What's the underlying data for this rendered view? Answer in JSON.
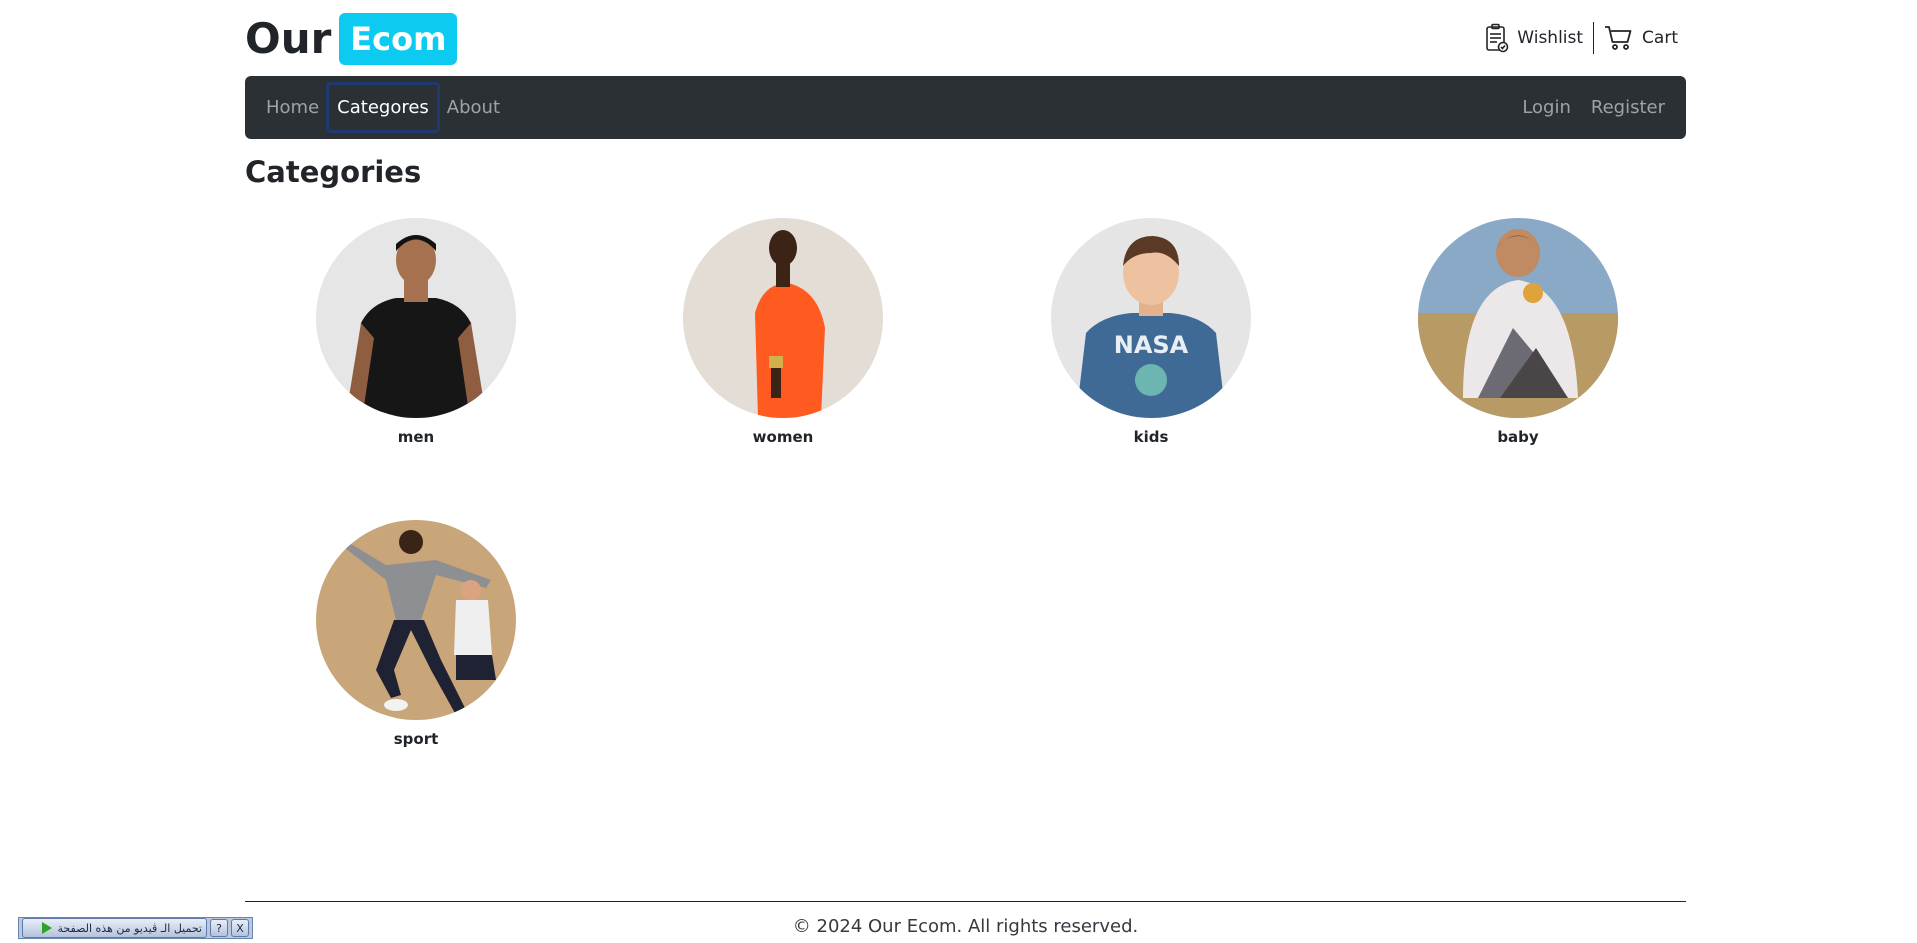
{
  "brand": {
    "word": "Our",
    "badge": "Ecom",
    "badge_color": "#0dcaf0"
  },
  "header_links": {
    "wishlist": "Wishlist",
    "cart": "Cart"
  },
  "nav": {
    "left": [
      "Home",
      "Categores",
      "About"
    ],
    "active": "Categores",
    "right": [
      "Login",
      "Register"
    ],
    "bg_color": "#2b3035"
  },
  "page": {
    "title": "Categories"
  },
  "categories": [
    {
      "label": "men",
      "image": "man-black-tshirt"
    },
    {
      "label": "women",
      "image": "woman-orange-dress"
    },
    {
      "label": "kids",
      "image": "boy-nasa-tshirt"
    },
    {
      "label": "baby",
      "image": "baby-knit-sweater"
    },
    {
      "label": "sport",
      "image": "men-jumping-sportswear"
    }
  ],
  "footer": {
    "text": "© 2024 Our Ecom. All rights reserved."
  },
  "video_widget": {
    "label": "تحميل الـ ڤيديو من هذه الصفحة",
    "help": "?",
    "close": "X"
  }
}
